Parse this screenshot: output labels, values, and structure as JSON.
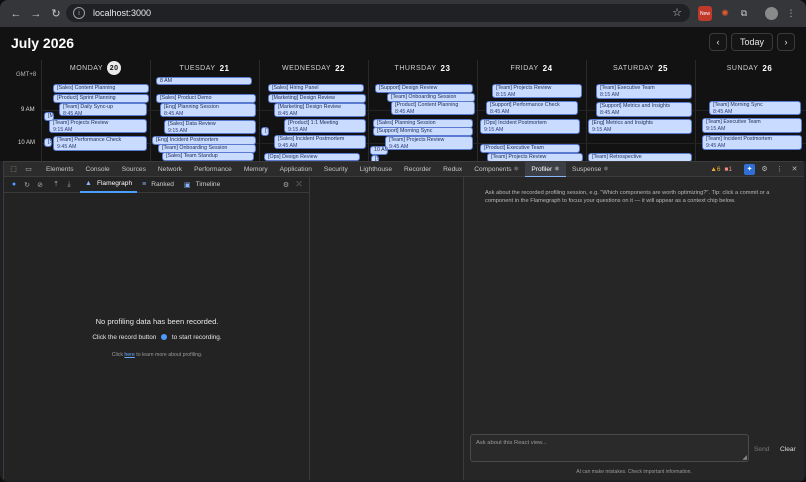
{
  "browser": {
    "url": "localhost:3000",
    "new_badge": "New"
  },
  "calendar": {
    "title": "July 2026",
    "today_label": "Today",
    "prev": "‹",
    "next": "›",
    "timezone": "GMT+8",
    "days": [
      {
        "name": "MONDAY",
        "num": "20",
        "today": true
      },
      {
        "name": "TUESDAY",
        "num": "21"
      },
      {
        "name": "WEDNESDAY",
        "num": "22"
      },
      {
        "name": "THURSDAY",
        "num": "23"
      },
      {
        "name": "FRIDAY",
        "num": "24"
      },
      {
        "name": "SATURDAY",
        "num": "25"
      },
      {
        "name": "SUNDAY",
        "num": "26"
      }
    ],
    "hours": [
      "9 AM",
      "10 AM"
    ],
    "events": [
      {
        "d": 0,
        "title": "[Sales] Content Planning",
        "time": ""
      },
      {
        "d": 0,
        "title": "[Product] Sprint Planning",
        "time": ""
      },
      {
        "d": 0,
        "title": "[Team] Daily Sync-up",
        "time": "8:45 AM"
      },
      {
        "d": 0,
        "title": "[Team] Projects Review",
        "time": "9:15 AM"
      },
      {
        "d": 0,
        "title": "[Team] Performance Check",
        "time": "9:45 AM"
      },
      {
        "d": 0,
        "title": "[Ma",
        "time": ""
      },
      {
        "d": 0,
        "title": "[S",
        "time": ""
      },
      {
        "d": 1,
        "title": "8 AM",
        "time": ""
      },
      {
        "d": 1,
        "title": "[Sales] Product Demo",
        "time": ""
      },
      {
        "d": 1,
        "title": "[Eng] Planning Session",
        "time": "8:45 AM"
      },
      {
        "d": 1,
        "title": "[Sales] Data Review",
        "time": "9:15 AM"
      },
      {
        "d": 1,
        "title": "[Eng] Incident Postmortem",
        "time": ""
      },
      {
        "d": 1,
        "title": "[Sales] Team Standup",
        "time": ""
      },
      {
        "d": 1,
        "title": "[Team] Onboarding Session",
        "time": ""
      },
      {
        "d": 2,
        "title": "[Sales] Hiring Panel",
        "time": ""
      },
      {
        "d": 2,
        "title": "[Marketing] Design Review",
        "time": ""
      },
      {
        "d": 2,
        "title": "[Marketing] Design Review",
        "time": "8:45 AM"
      },
      {
        "d": 2,
        "title": "[Product] 1:1 Meeting",
        "time": "9:15 AM"
      },
      {
        "d": 2,
        "title": "[Sales] Incident Postmortem",
        "time": "9:45 AM"
      },
      {
        "d": 2,
        "title": "[Ops] Design Review",
        "time": ""
      },
      {
        "d": 2,
        "title": "[T",
        "time": ""
      },
      {
        "d": 3,
        "title": "[Support] Design Review",
        "time": ""
      },
      {
        "d": 3,
        "title": "[Team] Onboarding Session",
        "time": ""
      },
      {
        "d": 3,
        "title": "[Product] Content Planning",
        "time": "8:45 AM"
      },
      {
        "d": 3,
        "title": "[Sales] Planning Session",
        "time": ""
      },
      {
        "d": 3,
        "title": "[Support] Morning Sync",
        "time": ""
      },
      {
        "d": 3,
        "title": "[Team] Projects Review",
        "time": "9:45 AM"
      },
      {
        "d": 3,
        "title": "10 AM",
        "time": ""
      },
      {
        "d": 3,
        "title": "[S",
        "time": ""
      },
      {
        "d": 4,
        "title": "[Team] Projects Review",
        "time": "8:15 AM"
      },
      {
        "d": 4,
        "title": "[Support] Performance Check",
        "time": "8:45 AM"
      },
      {
        "d": 4,
        "title": "[Ops] Incident Postmortem",
        "time": "9:15 AM"
      },
      {
        "d": 4,
        "title": "[Product] Executive Team",
        "time": ""
      },
      {
        "d": 4,
        "title": "[Team] Projects Review",
        "time": ""
      },
      {
        "d": 5,
        "title": "[Team] Executive Team",
        "time": "8:15 AM"
      },
      {
        "d": 5,
        "title": "[Support] Metrics and Insights",
        "time": "8:45 AM"
      },
      {
        "d": 5,
        "title": "[Eng] Metrics and Insights",
        "time": "9:15 AM"
      },
      {
        "d": 5,
        "title": "[Team] Retrospective",
        "time": ""
      },
      {
        "d": 6,
        "title": "[Team] Morning Sync",
        "time": "8:45 AM"
      },
      {
        "d": 6,
        "title": "[Team] Executive Team",
        "time": "9:15 AM"
      },
      {
        "d": 6,
        "title": "[Team] Incident Postmortem",
        "time": "9:45 AM"
      }
    ]
  },
  "devtools": {
    "tabs": [
      "Elements",
      "Console",
      "Sources",
      "Network",
      "Performance",
      "Memory",
      "Application",
      "Security",
      "Lighthouse",
      "Recorder",
      "Redux",
      "Components ⚛",
      "Profiler ⚛",
      "Suspense ⚛"
    ],
    "active_tab": "Profiler ⚛",
    "warnings": "6",
    "errors": "1",
    "profiler": {
      "tabs": [
        "Flamegraph",
        "Ranked",
        "Timeline"
      ],
      "empty_title": "No profiling data has been recorded.",
      "empty_hint_pre": "Click the record button",
      "empty_hint_post": "to start recording.",
      "learn_pre": "Click",
      "learn_link": "here",
      "learn_post": "to learn more about profiling."
    },
    "ai": {
      "hint": "Ask about the recorded profiling session, e.g. \"Which components are worth optimizing?\". Tip: click a commit or a component in the Flamegraph to focus your questions on it — it will appear as a context chip below.",
      "placeholder": "Ask about this React view...",
      "send": "Send",
      "clear": "Clear",
      "disclaimer": "AI can make mistakes. Check important information."
    }
  }
}
